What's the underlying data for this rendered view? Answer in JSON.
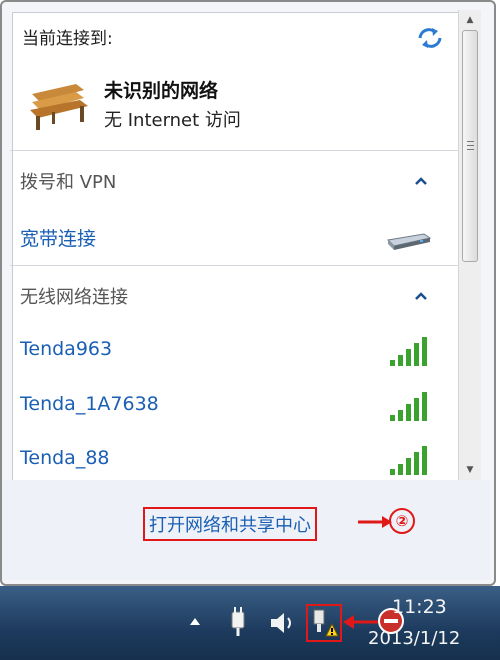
{
  "popup": {
    "current_connection_header": "当前连接到:",
    "network_name": "未识别的网络",
    "network_status": "无 Internet 访问",
    "sections": {
      "dialup_vpn": {
        "title": "拨号和 VPN",
        "items": [
          "宽带连接"
        ]
      },
      "wireless": {
        "title": "无线网络连接",
        "items": [
          "Tenda963",
          "Tenda_1A7638",
          "Tenda_88"
        ]
      }
    },
    "open_center_link": "打开网络和共享中心",
    "step_badge": "②"
  },
  "taskbar": {
    "time": "11:23",
    "date": "2013/1/12"
  },
  "colors": {
    "link": "#1a5fb4",
    "highlight_red": "#e01818",
    "taskbar": "#1d3b5e"
  },
  "icons": [
    "refresh-icon",
    "bench-icon",
    "collapse-icon",
    "modem-icon",
    "signal-icon",
    "scroll-up-icon",
    "scroll-down-icon",
    "tray-expand-icon",
    "power-plug-icon",
    "volume-icon",
    "network-warning-icon",
    "tray-app-icon"
  ]
}
